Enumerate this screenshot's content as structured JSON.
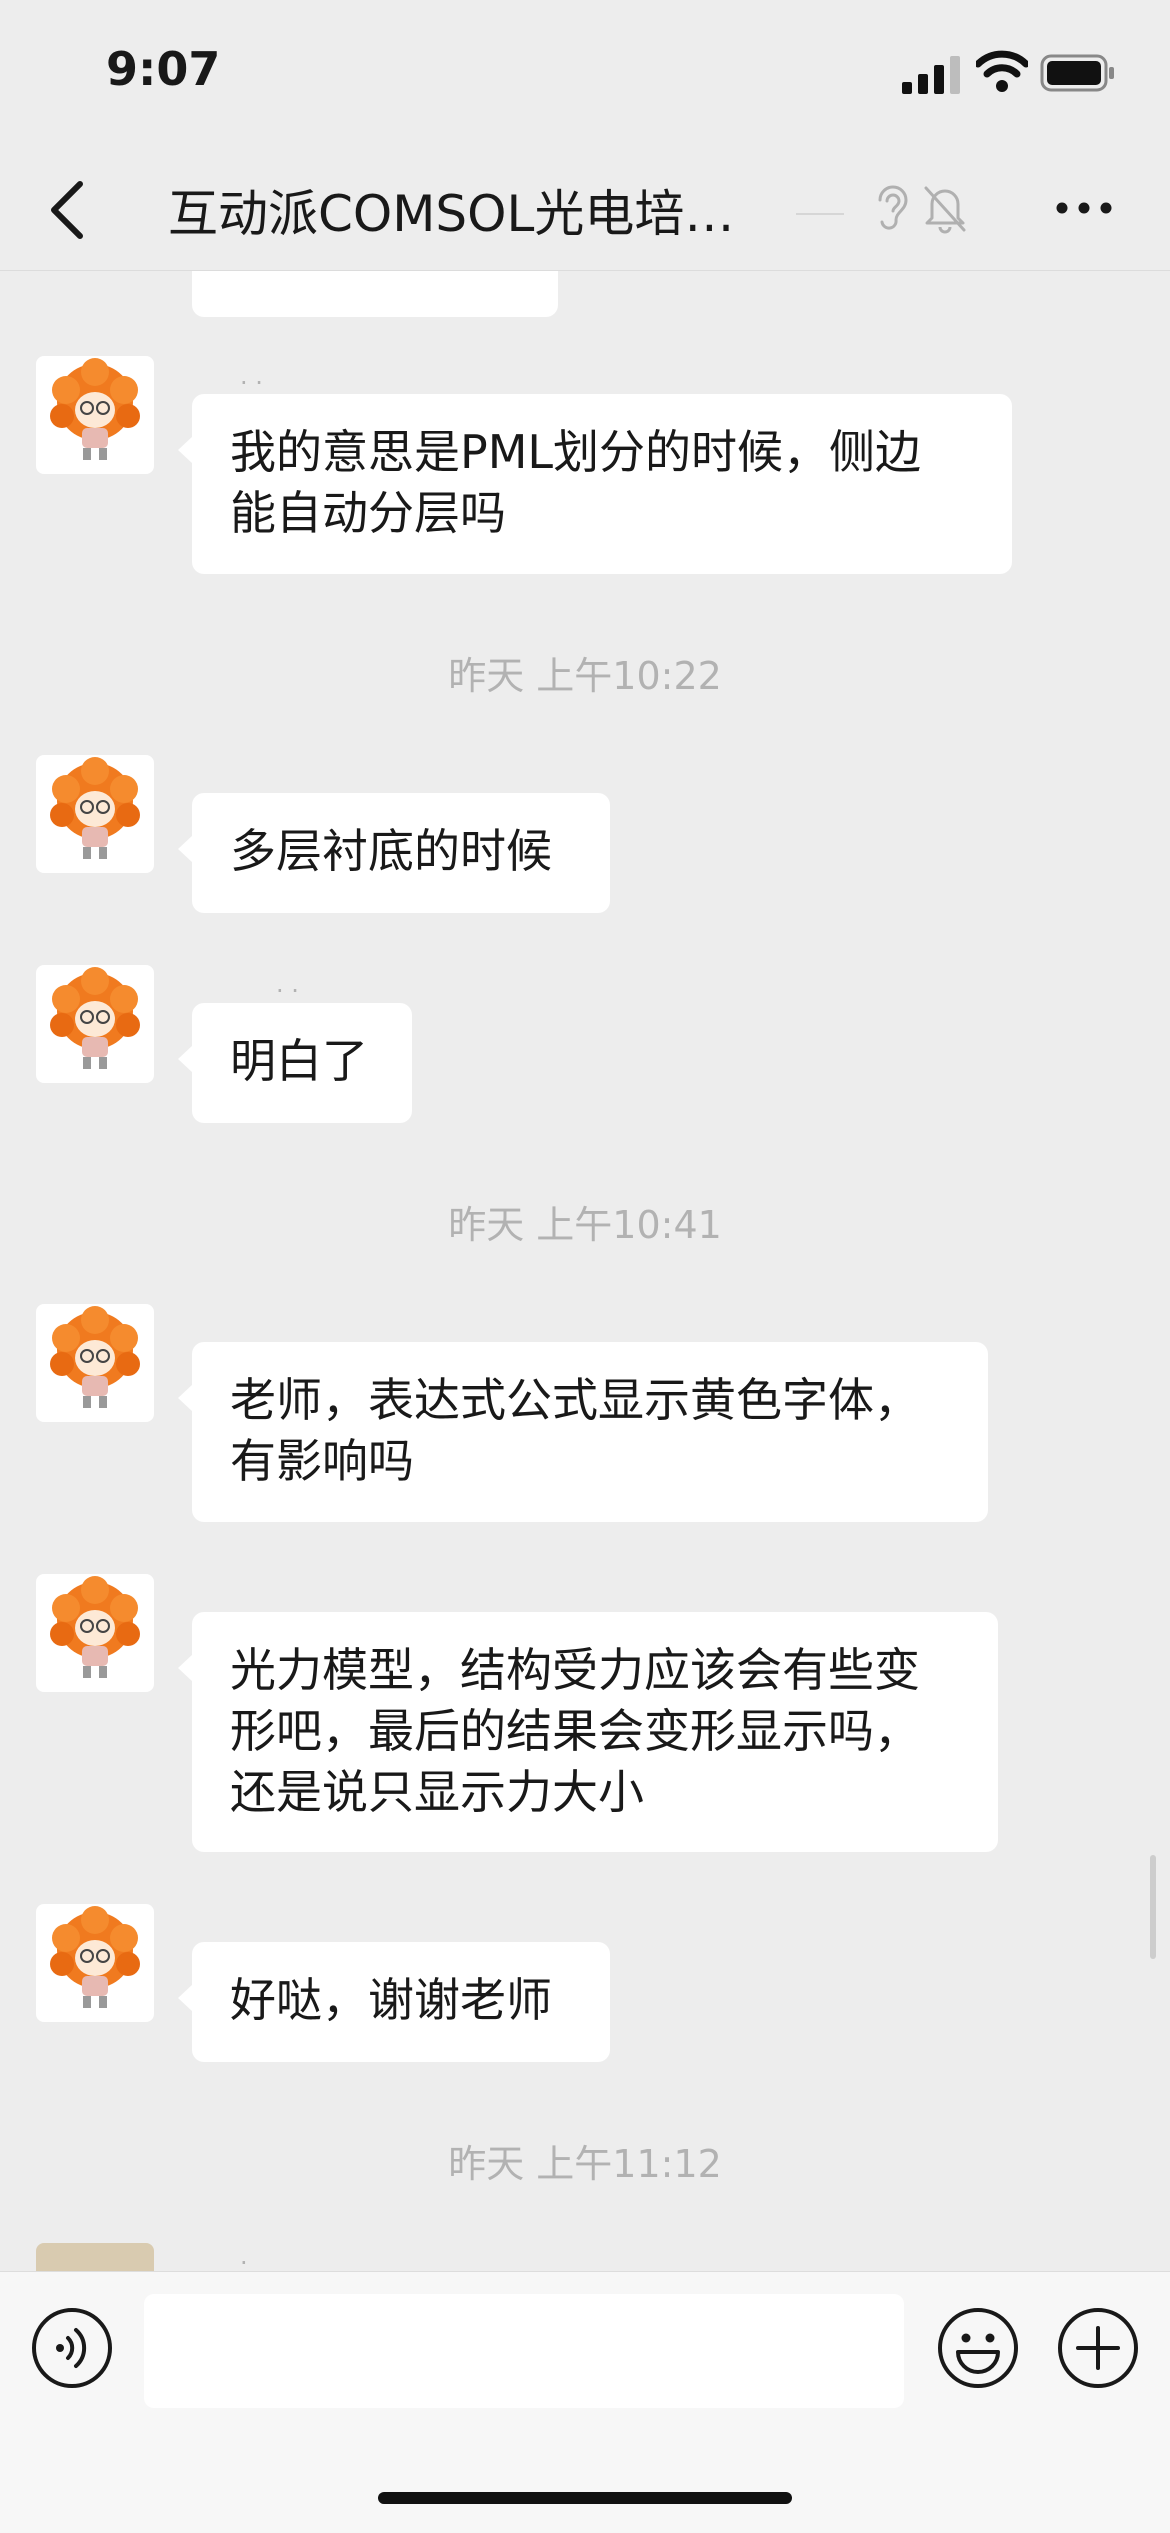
{
  "status_bar": {
    "time": "9:07",
    "icons": [
      "signal-icon",
      "wifi-icon",
      "battery-icon"
    ]
  },
  "header": {
    "title": "互动派COMSOL光电培…",
    "icons": [
      "back-icon",
      "ear-icon",
      "mute-bell-icon",
      "more-icon"
    ]
  },
  "messages": [
    {
      "text": "我的意思是PML划分的时候，侧边能自动分层吗",
      "line1": "我的意思是PML划分的时候，侧边",
      "line2": "能自动分层吗"
    },
    {
      "timestamp": "昨天 上午10:22"
    },
    {
      "text": "多层衬底的时候"
    },
    {
      "text": "明白了"
    },
    {
      "timestamp": "昨天 上午10:41"
    },
    {
      "text": "老师，表达式公式显示黄色字体，有影响吗",
      "line1": "老师，表达式公式显示黄色字体，",
      "line2": "有影响吗"
    },
    {
      "text": "光力模型，结构受力应该会有些变形吧，最后的结果会变形显示吗，还是说只显示力大小",
      "line1": "光力模型，结构受力应该会有些变",
      "line2": "形吧，最后的结果会变形显示吗，",
      "line3": "还是说只显示力大小"
    },
    {
      "text": "好哒，谢谢老师"
    },
    {
      "timestamp": "昨天 上午11:12"
    }
  ],
  "input_bar": {
    "value": "",
    "icons": [
      "voice-icon",
      "emoji-icon",
      "plus-icon"
    ]
  },
  "colors": {
    "background": "#ededed",
    "bubble": "#ffffff",
    "timestamp": "#b2b2b2",
    "avatar_hair": "#f07a1f"
  }
}
